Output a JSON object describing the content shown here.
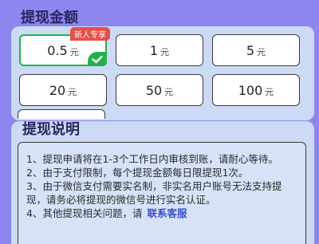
{
  "amount_section": {
    "title": "提现金额",
    "options": [
      {
        "amount": "0.5",
        "unit": "元",
        "selected": true,
        "badge": "新人专享"
      },
      {
        "amount": "1",
        "unit": "元",
        "selected": false
      },
      {
        "amount": "5",
        "unit": "元",
        "selected": false
      },
      {
        "amount": "20",
        "unit": "元",
        "selected": false
      },
      {
        "amount": "50",
        "unit": "元",
        "selected": false
      },
      {
        "amount": "100",
        "unit": "元",
        "selected": false
      }
    ],
    "selected_icon": "checkmark-icon"
  },
  "description_section": {
    "title": "提现说明",
    "rules": [
      "1、提现申请将在1-3个工作日内审核到账，请耐心等待。",
      "2、由于支付限制，每个提现金额每日限提现1次。",
      "3、由于微信支付需要实名制，非实名用户账号无法支持提现，请务必将提现的微信号进行实名认证。",
      "4、其他提现相关问题，请"
    ],
    "contact_link": "联系客服"
  },
  "colors": {
    "background": "#8c86ee",
    "panel": "#ccdaf5",
    "selected_border": "#22b14c",
    "badge": "#e74f48",
    "link": "#3b4fc8"
  }
}
